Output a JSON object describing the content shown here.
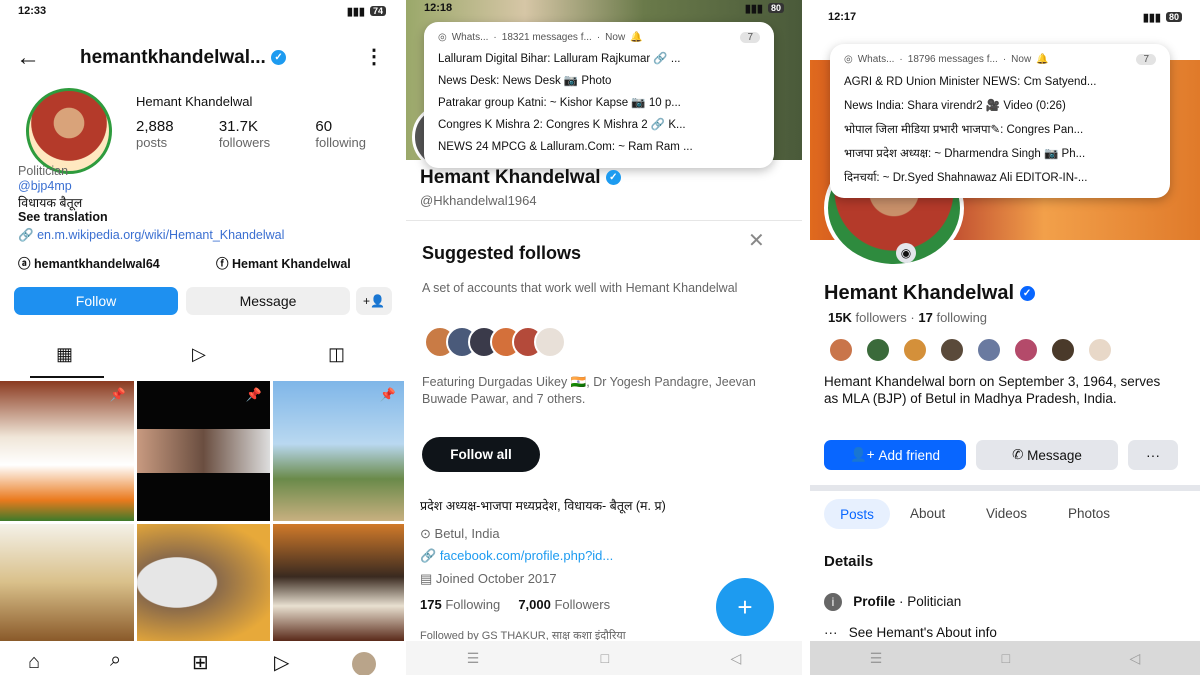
{
  "instagram": {
    "status": {
      "time": "12:33",
      "battery": "74"
    },
    "header": {
      "username": "hemantkhandelwal...",
      "back_icon": "arrow-left-icon",
      "menu_icon": "kebab-icon"
    },
    "profile": {
      "display_name": "Hemant Khandelwal",
      "stats": [
        {
          "value": "2,888",
          "label": "posts"
        },
        {
          "value": "31.7K",
          "label": "followers"
        },
        {
          "value": "60",
          "label": "following"
        }
      ],
      "category": "Politician",
      "mention": "@bjp4mp",
      "bio": "विधायक बैतूल",
      "see_translation": "See translation",
      "link": "en.m.wikipedia.org/wiki/Hemant_Khandelwal",
      "threads": "hemantkhandelwal64",
      "facebook": "Hemant Khandelwal"
    },
    "buttons": {
      "follow": "Follow",
      "message": "Message"
    },
    "colors": {
      "follow": "#1e90f0",
      "verified": "#1d9bf0"
    }
  },
  "twitter": {
    "status": {
      "time": "12:18",
      "battery": "80"
    },
    "notification": {
      "app": "Whats...",
      "summary": "18321 messages f...",
      "when": "Now",
      "count": "7",
      "rows": [
        "Lalluram Digital Bihar: Lalluram Rajkumar 🔗 ...",
        "News Desk: News Desk 📷 Photo",
        "Patrakar group Katni: ~ Kishor Kapse 📷 10 p...",
        "Congres K Mishra 2: Congres K Mishra 2 🔗 K...",
        "NEWS 24 MPCG & Lalluram.Com: ~ Ram Ram ..."
      ]
    },
    "profile": {
      "name": "Hemant Khandelwal",
      "handle": "@Hkhandelwal1964"
    },
    "suggested": {
      "title": "Suggested follows",
      "desc": "A set of accounts that work well with Hemant Khandelwal",
      "featuring": "Featuring Durgadas Uikey 🇮🇳, Dr Yogesh Pandagre, Jeevan Buwade Pawar, and 7 others.",
      "follow_all": "Follow all"
    },
    "bio": "प्रदेश अध्यक्ष-भाजपा मध्यप्रदेश, विधायक- बैतूल (म. प्र)",
    "location": "Betul, India",
    "link": "facebook.com/profile.php?id...",
    "joined": "Joined October 2017",
    "following_count": "175",
    "following_label": "Following",
    "followers_count": "7,000",
    "followers_label": "Followers",
    "followed_by": "Followed by GS THAKUR, साक्ष कशा इंदौरिया",
    "fab": "+"
  },
  "facebook": {
    "status": {
      "time": "12:17",
      "battery": "80"
    },
    "notification": {
      "app": "Whats...",
      "summary": "18796 messages f...",
      "when": "Now",
      "count": "7",
      "rows": [
        "AGRI & RD Union Minister NEWS: Cm Satyend...",
        "News India: Shara virendr2 🎥 Video (0:26)",
        "भोपाल जिला मीडिया प्रभारी भाजपा✎: Congres Pan...",
        "भाजपा प्रदेश अध्यक्ष: ~ Dharmendra Singh 📷 Ph...",
        "दिनचर्या: ~ Dr.Syed Shahnawaz Ali EDITOR-IN-..."
      ]
    },
    "profile": {
      "name": "Hemant Khandelwal",
      "followers_count": "15K",
      "followers_label": "followers",
      "following_count": "17",
      "following_label": "following",
      "about": "Hemant Khandelwal born on September 3, 1964, serves as MLA (BJP) of Betul in Madhya Pradesh, India."
    },
    "buttons": {
      "add_friend": "Add friend",
      "message": "Message",
      "more": "···"
    },
    "tabs": [
      "Posts",
      "About",
      "Videos",
      "Photos"
    ],
    "details": {
      "title": "Details",
      "profile_label": "Profile",
      "profile_value": " · Politician",
      "see_about": "See Hemant's About info"
    },
    "colors": {
      "add_friend": "#0866ff"
    }
  }
}
